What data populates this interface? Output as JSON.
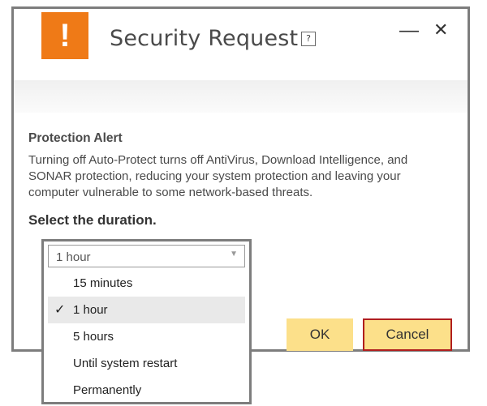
{
  "window": {
    "title": "Security Request",
    "help_label": "?",
    "minimize_label": "—",
    "close_label": "✕",
    "badge_glyph": "!"
  },
  "alert": {
    "title": "Protection Alert",
    "body": "Turning off Auto-Protect turns off AntiVirus, Download Intelligence, and SONAR protection, reducing your system protection and leaving your computer vulnerable to some network-based threats."
  },
  "duration": {
    "label": "Select the duration.",
    "selected": "1 hour",
    "options": [
      {
        "label": "15 minutes",
        "checked": false
      },
      {
        "label": "1 hour",
        "checked": true
      },
      {
        "label": "5 hours",
        "checked": false
      },
      {
        "label": "Until system restart",
        "checked": false
      },
      {
        "label": "Permanently",
        "checked": false
      }
    ]
  },
  "buttons": {
    "ok": "OK",
    "cancel": "Cancel"
  },
  "colors": {
    "badge": "#ef7a17",
    "button": "#fce08a",
    "cancel_border": "#b01e1e",
    "frame": "#7d7d7d"
  },
  "icons": {
    "check": "✓",
    "caret": "▼"
  }
}
